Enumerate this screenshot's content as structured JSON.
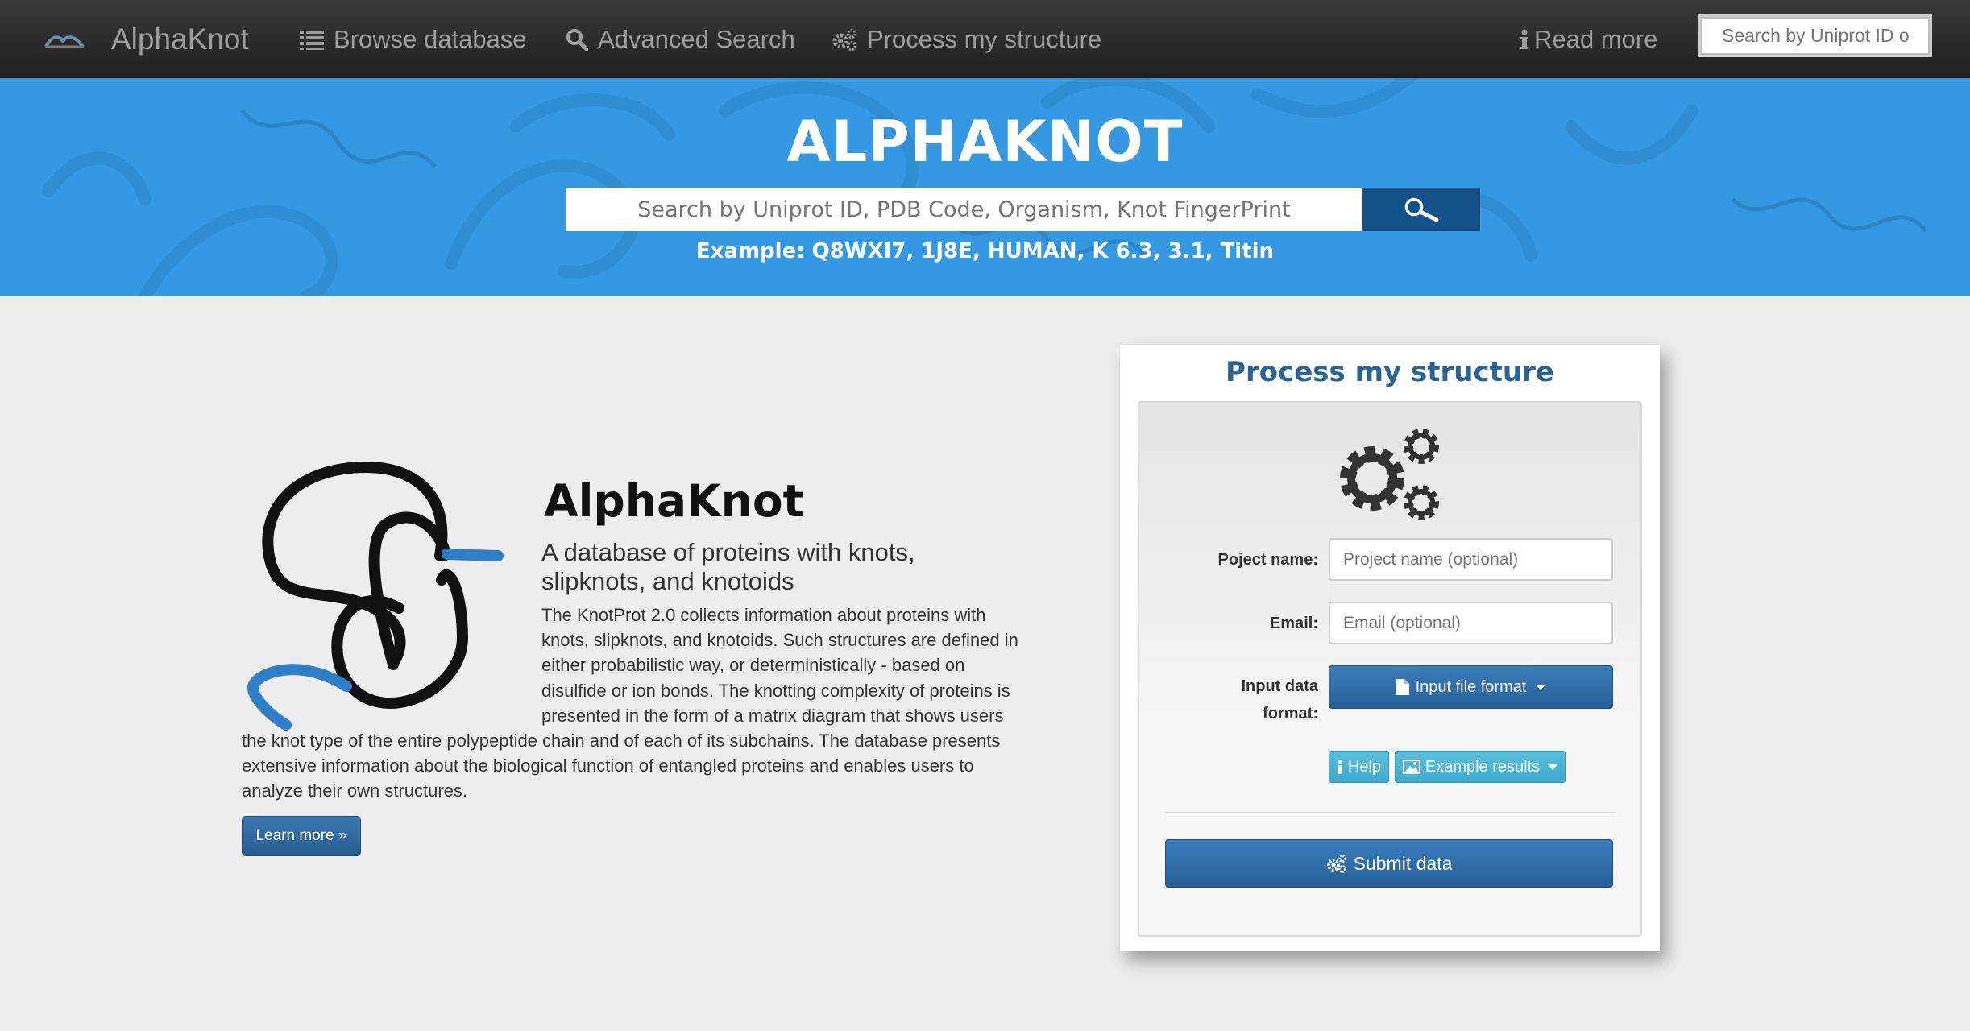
{
  "navbar": {
    "brand": "AlphaKnot",
    "items": [
      {
        "label": "Browse database",
        "icon": "list-icon"
      },
      {
        "label": "Advanced Search",
        "icon": "search-icon"
      },
      {
        "label": "Process my structure",
        "icon": "gears-icon"
      },
      {
        "label": "Read more",
        "icon": "info-icon"
      }
    ],
    "search_placeholder": "Search by Uniprot ID or PDB code"
  },
  "hero": {
    "title": "ALPHAKNOT",
    "search_placeholder": "Search by Uniprot ID, PDB Code, Organism, Knot FingerPrint",
    "example": "Example: Q8WXI7, 1J8E, HUMAN, K 6.3, 3.1, Titin"
  },
  "about": {
    "title": "AlphaKnot",
    "subtitle": "A database of proteins with knots, slipknots, and knotoids",
    "text": "The KnotProt 2.0 collects information about proteins with knots, slipknots, and knotoids. Such structures are defined in either probabilistic way, or deterministically - based on disulfide or ion bonds. The knotting complexity of proteins is presented in the form of a matrix diagram that shows users the knot type of the entire polypeptide chain and of each of its subchains. The database presents extensive information about the biological function of entangled proteins and enables users to analyze their own structures.",
    "learn_more": "Learn more »"
  },
  "process_card": {
    "title": "Process my structure",
    "project_label": "Poject name:",
    "project_placeholder": "Project name (optional)",
    "email_label": "Email:",
    "email_placeholder": "Email (optional)",
    "format_label_line1": "Input data",
    "format_label_line2": "format:",
    "format_button": "Input file format",
    "help_button": "Help",
    "example_button": "Example results",
    "submit_button": "Submit data"
  },
  "colors": {
    "navbar": "#222222",
    "hero": "#3498e2",
    "hero_search_button": "#135389",
    "primary_button": "#2e6da4",
    "info_button": "#5bc0de",
    "card_title": "#2a6496",
    "page_background": "#ededed"
  }
}
